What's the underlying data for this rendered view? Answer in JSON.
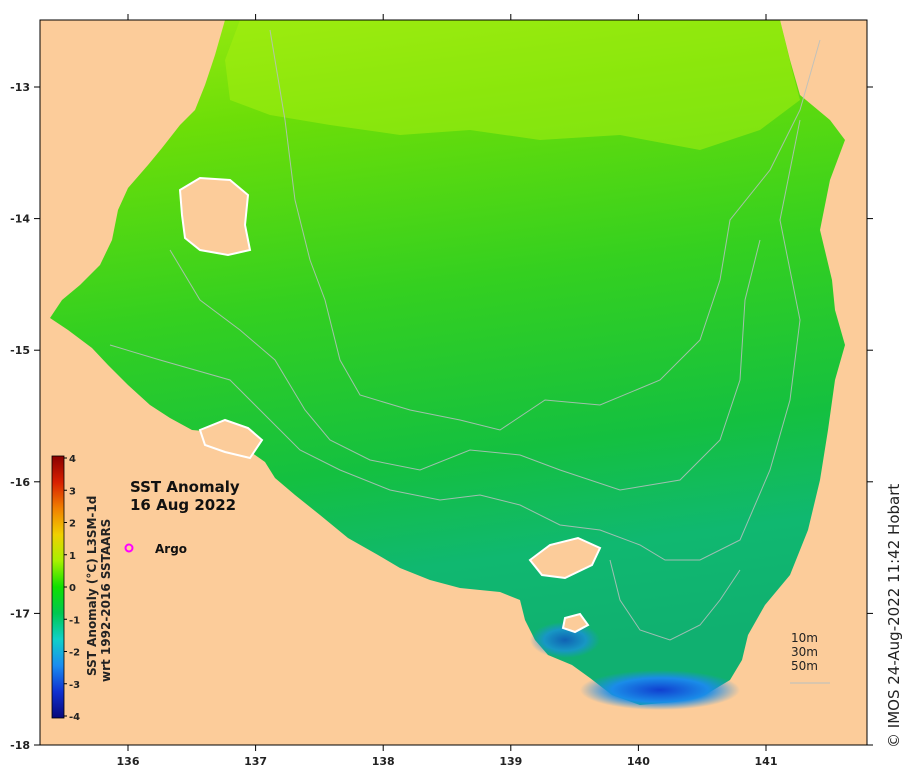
{
  "map": {
    "title_line1": "SST Anomaly",
    "title_line2": "16 Aug 2022",
    "legend_argo_label": "Argo",
    "argo_marker_color": "#ff00ff",
    "land_color": "#fccc9a",
    "depth_legend": [
      "10m",
      "30m",
      "50m"
    ],
    "x_ticks": [
      "136",
      "137",
      "138",
      "139",
      "140",
      "141"
    ],
    "y_ticks": [
      "-13",
      "-14",
      "-15",
      "-16",
      "-17",
      "-18"
    ]
  },
  "colorbar": {
    "ticks": [
      "4",
      "3",
      "2",
      "1",
      "0",
      "-1",
      "-2",
      "-3",
      "-4"
    ],
    "label_line1": "SST Anomaly (°C) L3SM-1d",
    "label_line2": "wrt 1992-2016 SSTAARS",
    "stops": [
      "#08087a",
      "#1030d0",
      "#1a8cf0",
      "#10d0c8",
      "#00c850",
      "#10e000",
      "#a8f000",
      "#f0d000",
      "#f08000",
      "#d82000",
      "#8a0000"
    ]
  },
  "credit": "© IMOS 24-Aug-2022 11:42 Hobart"
}
